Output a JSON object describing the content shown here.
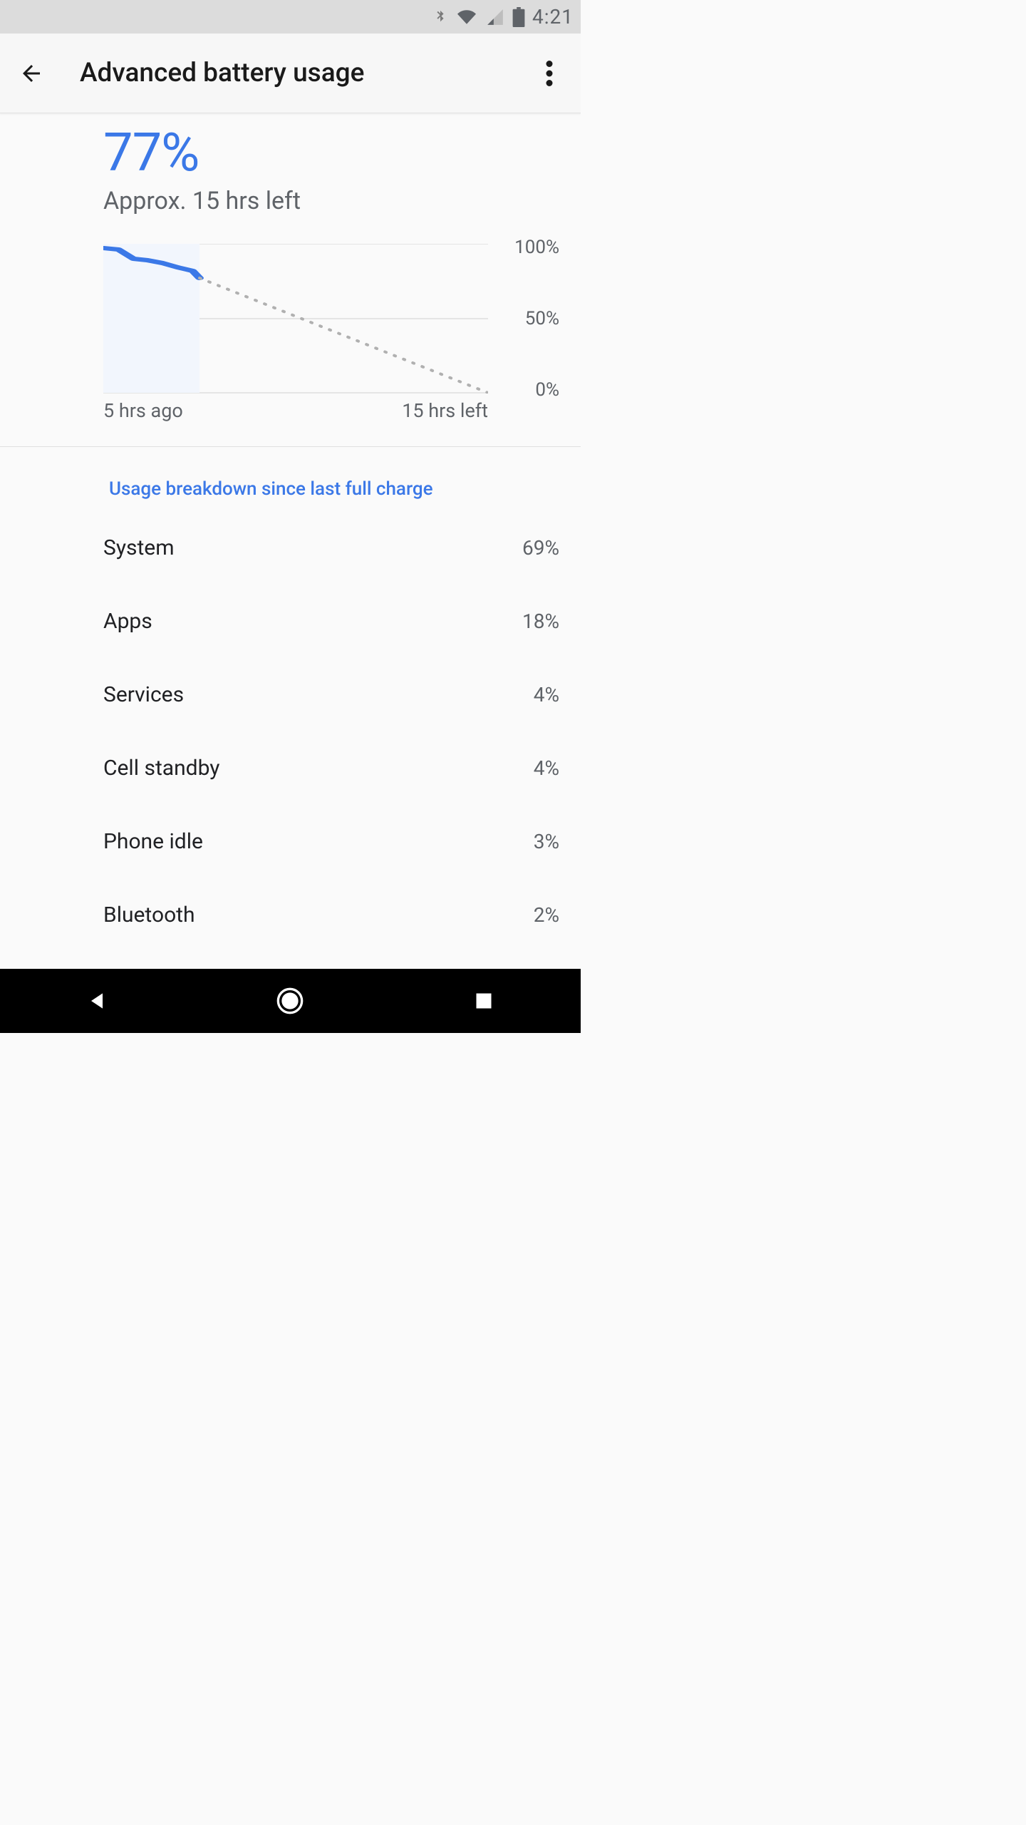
{
  "status": {
    "time": "4:21"
  },
  "header": {
    "title": "Advanced battery usage"
  },
  "battery": {
    "percent": "77%",
    "estimate": "Approx. 15 hrs left"
  },
  "chart_data": {
    "type": "line",
    "title": "",
    "xlabel": "",
    "ylabel": "",
    "ylim": [
      0,
      100
    ],
    "y_ticks": [
      "100%",
      "50%",
      "0%"
    ],
    "x_ticks": [
      "5 hrs ago",
      "15 hrs left"
    ],
    "elapsed_hours": 5,
    "remaining_hours": 15,
    "series": [
      {
        "name": "history",
        "style": "solid",
        "color": "#3b78e7",
        "x_hours_ago": [
          5.0,
          4.6,
          4.2,
          3.8,
          3.4,
          3.0,
          2.6,
          2.4
        ],
        "values": [
          97,
          96,
          90,
          89,
          87,
          84,
          82,
          77
        ]
      },
      {
        "name": "projection",
        "style": "dotted",
        "color": "#b0b0b0",
        "x_hours_from_now": [
          0,
          15
        ],
        "values": [
          77,
          0
        ]
      }
    ]
  },
  "breakdown": {
    "title": "Usage breakdown since last full charge",
    "items": [
      {
        "label": "System",
        "value": "69%"
      },
      {
        "label": "Apps",
        "value": "18%"
      },
      {
        "label": "Services",
        "value": "4%"
      },
      {
        "label": "Cell standby",
        "value": "4%"
      },
      {
        "label": "Phone idle",
        "value": "3%"
      },
      {
        "label": "Bluetooth",
        "value": "2%"
      }
    ]
  }
}
